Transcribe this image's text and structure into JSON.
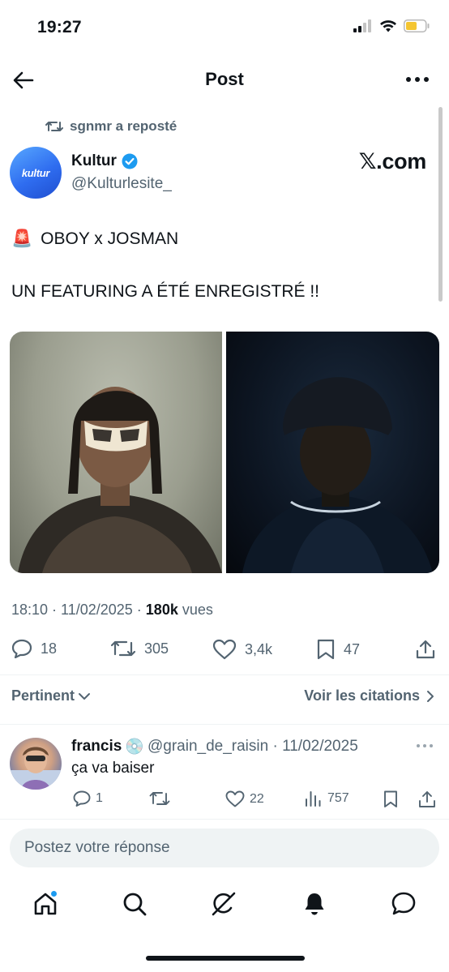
{
  "status_bar": {
    "time": "19:27",
    "battery_color": "#f4c531"
  },
  "header": {
    "title": "Post",
    "back_icon": "arrow-left-icon",
    "more_icon": "more-horizontal-icon"
  },
  "repost": {
    "text": "sgnmr a reposté",
    "icon": "repost-icon"
  },
  "post": {
    "avatar_text": "kultur",
    "author_name": "Kultur",
    "verified": true,
    "author_handle": "@Kulturlesite_",
    "watermark": "𝕏.com",
    "line1_emoji": "🚨",
    "line1_text": "OBOY x JOSMAN",
    "line2_text": "UN FEATURING A ÉTÉ ENREGISTRÉ !!",
    "time_date": "18:10 · 11/02/2025 · ",
    "views_count": "180k",
    "views_label": " vues",
    "stats": {
      "replies": "18",
      "reposts": "305",
      "likes": "3,4k",
      "bookmarks": "47"
    }
  },
  "replies_section": {
    "sort_label": "Pertinent",
    "quotes_label": "Voir les citations"
  },
  "reply": {
    "name": "francis",
    "name_emoji": "💿",
    "handle_date": "@grain_de_raisin · 11/02/2025",
    "text": "ça va baiser",
    "stats": {
      "replies": "1",
      "reposts": "",
      "likes": "22",
      "views": "757"
    }
  },
  "composer": {
    "placeholder": "Postez votre réponse"
  },
  "tabbar": {
    "items": [
      "home",
      "search",
      "grok",
      "notifications",
      "messages"
    ],
    "home_has_badge": true
  },
  "colors": {
    "accent": "#1d9bf0",
    "text": "#0f1419",
    "secondary": "#536471"
  }
}
